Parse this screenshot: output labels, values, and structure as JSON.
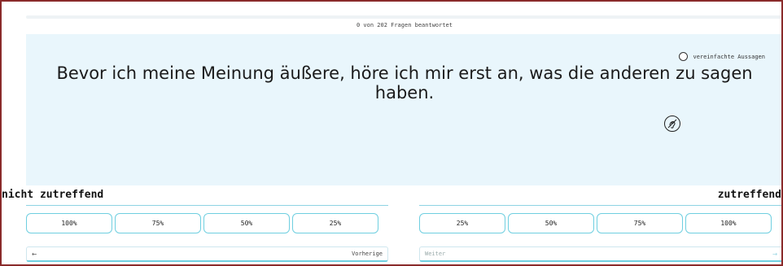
{
  "progress": {
    "text": "0 von 202 Fragen beantwortet",
    "fraction": 0
  },
  "question": {
    "text": "Bevor ich meine Meinung äußere, höre ich mir erst an, was die anderen zu sagen haben."
  },
  "simplified_toggle": {
    "label": "vereinfachte Aussagen",
    "checked": false
  },
  "scale": {
    "left_label": "nicht zutreffend",
    "right_label": "zutreffend",
    "left_options": [
      "100%",
      "75%",
      "50%",
      "25%"
    ],
    "right_options": [
      "25%",
      "50%",
      "75%",
      "100%"
    ]
  },
  "nav": {
    "prev_label": "Vorherige",
    "prev_icon": "arrow-left-icon",
    "next_label": "Weiter",
    "next_icon": "arrow-right-icon"
  },
  "colors": {
    "accent": "#6fcfe0",
    "panel_bg": "#e9f6fc",
    "frame_border": "#8a2a2a"
  }
}
